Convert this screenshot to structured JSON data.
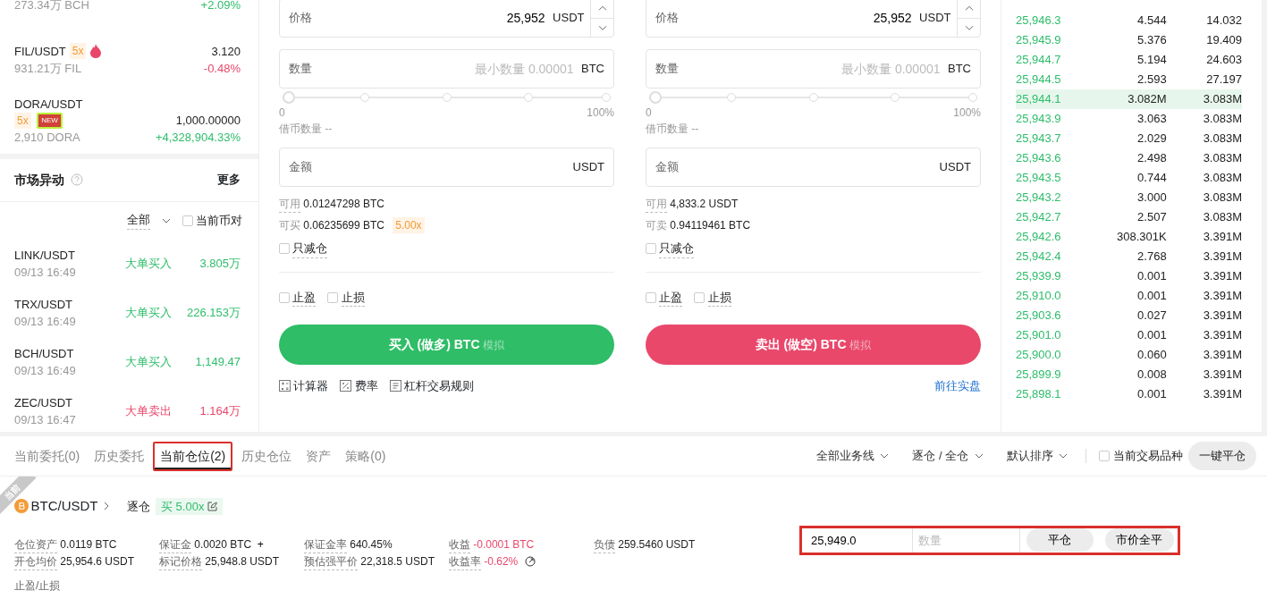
{
  "market_list": [
    {
      "volume": "273.34万 BCH",
      "change": "+2.09%",
      "falling": false
    },
    {
      "pair": "FIL/USDT",
      "leverage": "5x",
      "hot": true,
      "price": "3.120",
      "volume": "931.21万 FIL",
      "change": "-0.48%",
      "falling": true
    },
    {
      "pair": "DORA/USDT",
      "leverage": "5x",
      "badge": "NEW",
      "price": "1,000.00000",
      "volume": "2,910 DORA",
      "change": "+4,328,904.33%",
      "falling": false
    }
  ],
  "market_moves": {
    "title": "市场异动",
    "more": "更多",
    "filter": "全部",
    "pair_filter": {
      "label": "当前币对",
      "checked": false
    },
    "items": [
      {
        "pair": "LINK/USDT",
        "time": "09/13 16:49",
        "action": "大单买入",
        "amount": "3.805万",
        "kind": "buy"
      },
      {
        "pair": "TRX/USDT",
        "time": "09/13 16:49",
        "action": "大单买入",
        "amount": "226.153万",
        "kind": "buy"
      },
      {
        "pair": "BCH/USDT",
        "time": "09/13 16:49",
        "action": "大单买入",
        "amount": "1,149.47",
        "kind": "buy"
      },
      {
        "pair": "ZEC/USDT",
        "time": "09/13 16:47",
        "action": "大单卖出",
        "amount": "1.164万",
        "kind": "sell"
      }
    ]
  },
  "order_forms": [
    {
      "kind": "buy",
      "price_label": "价格",
      "price": "25,952",
      "price_unit": "USDT",
      "qty_label": "数量",
      "qty_placeholder": "最小数量 0.00001",
      "qty_unit": "BTC",
      "level": 0,
      "slider_min": "0",
      "slider_max": "100%",
      "borrow": "借币数量 --",
      "amount_label": "金额",
      "amount_unit": "USDT",
      "available_label": "可用",
      "available": "0.01247298 BTC",
      "max_label": "可买",
      "max_value": "0.06235699 BTC",
      "leverage": "5.00x",
      "reduce_only": {
        "label": "只减仓",
        "checked": false
      },
      "take_profit": {
        "label": "止盈",
        "checked": false
      },
      "stop_loss": {
        "label": "止损",
        "checked": false
      },
      "button": "买入 (做多) BTC",
      "button_tag": "模拟"
    },
    {
      "kind": "sell",
      "price_label": "价格",
      "price": "25,952",
      "price_unit": "USDT",
      "qty_label": "数量",
      "qty_placeholder": "最小数量 0.00001",
      "qty_unit": "BTC",
      "level": 0,
      "slider_min": "0",
      "slider_max": "100%",
      "borrow": "借币数量 --",
      "amount_label": "金额",
      "amount_unit": "USDT",
      "available_label": "可用",
      "available": "4,833.2 USDT",
      "max_label": "可卖",
      "max_value": "0.94119461 BTC",
      "reduce_only": {
        "label": "只减仓",
        "checked": false
      },
      "take_profit": {
        "label": "止盈",
        "checked": false
      },
      "stop_loss": {
        "label": "止损",
        "checked": false
      },
      "button": "卖出 (做空) BTC",
      "button_tag": "模拟"
    }
  ],
  "form_links": [
    {
      "label": "计算器",
      "kind": "calculator"
    },
    {
      "label": "费率",
      "kind": "rate"
    },
    {
      "label": "杠杆交易规则",
      "kind": "rules"
    }
  ],
  "live_link": "前往实盘",
  "order_book": [
    {
      "price": "25,946.3",
      "amount": "4.544",
      "total": "14.032",
      "highlighted": false
    },
    {
      "price": "25,945.9",
      "amount": "5.376",
      "total": "19.409",
      "highlighted": false
    },
    {
      "price": "25,944.7",
      "amount": "5.194",
      "total": "24.603",
      "highlighted": false
    },
    {
      "price": "25,944.5",
      "amount": "2.593",
      "total": "27.197",
      "highlighted": false
    },
    {
      "price": "25,944.1",
      "amount": "3.082M",
      "total": "3.083M",
      "highlighted": true
    },
    {
      "price": "25,943.9",
      "amount": "3.063",
      "total": "3.083M",
      "highlighted": false
    },
    {
      "price": "25,943.7",
      "amount": "2.029",
      "total": "3.083M",
      "highlighted": false
    },
    {
      "price": "25,943.6",
      "amount": "2.498",
      "total": "3.083M",
      "highlighted": false
    },
    {
      "price": "25,943.5",
      "amount": "0.744",
      "total": "3.083M",
      "highlighted": false
    },
    {
      "price": "25,943.2",
      "amount": "3.000",
      "total": "3.083M",
      "highlighted": false
    },
    {
      "price": "25,942.7",
      "amount": "2.507",
      "total": "3.083M",
      "highlighted": false
    },
    {
      "price": "25,942.6",
      "amount": "308.301K",
      "total": "3.391M",
      "highlighted": false
    },
    {
      "price": "25,942.4",
      "amount": "2.768",
      "total": "3.391M",
      "highlighted": false
    },
    {
      "price": "25,939.9",
      "amount": "0.001",
      "total": "3.391M",
      "highlighted": false
    },
    {
      "price": "25,910.0",
      "amount": "0.001",
      "total": "3.391M",
      "highlighted": false
    },
    {
      "price": "25,903.6",
      "amount": "0.027",
      "total": "3.391M",
      "highlighted": false
    },
    {
      "price": "25,901.0",
      "amount": "0.001",
      "total": "3.391M",
      "highlighted": false
    },
    {
      "price": "25,900.0",
      "amount": "0.060",
      "total": "3.391M",
      "highlighted": false
    },
    {
      "price": "25,899.9",
      "amount": "0.008",
      "total": "3.391M",
      "highlighted": false
    },
    {
      "price": "25,898.1",
      "amount": "0.001",
      "total": "3.391M",
      "highlighted": false
    }
  ],
  "orders_panel": {
    "tabs": [
      {
        "label": "当前委托(0)",
        "selected": false
      },
      {
        "label": "历史委托",
        "selected": false
      },
      {
        "label": "当前仓位(2)",
        "selected": true
      },
      {
        "label": "历史仓位",
        "selected": false
      },
      {
        "label": "资产",
        "selected": false
      },
      {
        "label": "策略(0)",
        "selected": false
      }
    ],
    "filters": [
      "全部业务线",
      "逐仓 / 全仓",
      "默认排序"
    ],
    "symbol_filter": {
      "label": "当前交易品种",
      "checked": false
    },
    "close_all": "一键平仓",
    "position": {
      "ribbon": "当前",
      "symbol": "BTC/USDT",
      "margin_mode": "逐仓",
      "direction": "买 5.00x",
      "columns": [
        [
          {
            "label": "仓位资产",
            "value": "0.0119 BTC",
            "negative": false
          },
          {
            "label": "开仓均价",
            "value": "25,954.6 USDT",
            "negative": false
          }
        ],
        [
          {
            "label": "保证金",
            "value": "0.0020 BTC",
            "negative": false,
            "action": "+"
          },
          {
            "label": "标记价格",
            "value": "25,948.8 USDT",
            "negative": false
          }
        ],
        [
          {
            "label": "保证金率",
            "value": "640.45%",
            "negative": false
          },
          {
            "label": "预估强平价",
            "value": "22,318.5 USDT",
            "negative": false
          }
        ],
        [
          {
            "label": "收益",
            "value": "-0.0001 BTC",
            "negative": true
          },
          {
            "label": "收益率",
            "value": "-0.62%",
            "negative": true,
            "share": true
          }
        ],
        [
          {
            "label": "负债",
            "value": "259.5460 USDT",
            "negative": false
          }
        ]
      ],
      "tp_sl": "止盈/止损",
      "close_price": "25,949.0",
      "close_qty_placeholder": "数量",
      "close_button": "平仓",
      "market_close_button": "市价全平"
    }
  }
}
